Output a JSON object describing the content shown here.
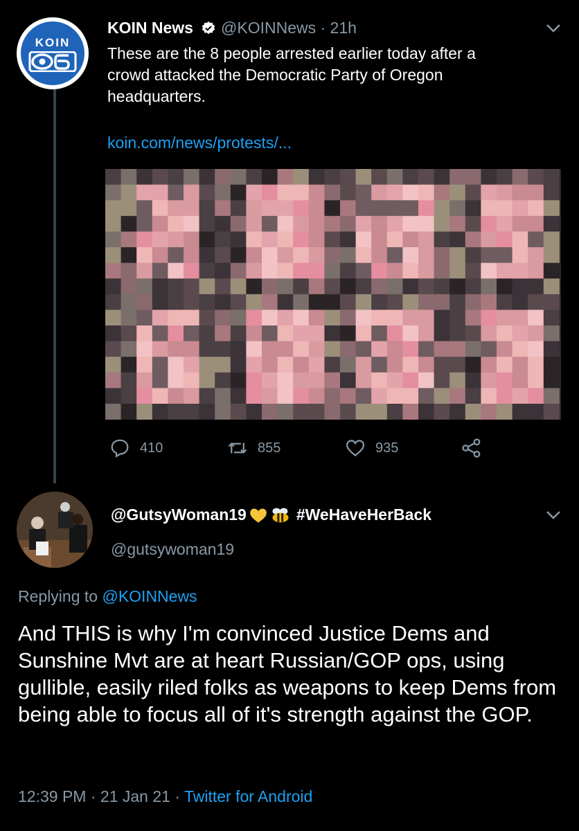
{
  "tweet1": {
    "display_name": "KOIN News",
    "handle": "@KOINNews",
    "separator": " · ",
    "time": "21h",
    "avatar_text_top": "KOIN",
    "avatar_text_bottom": "06",
    "text": "These are the 8 people arrested earlier today after a\ncrowd attacked the Democratic Party of Oregon\nheadquarters.",
    "link": "koin.com/news/protests/...",
    "actions": {
      "replies": "410",
      "retweets": "855",
      "likes": "935"
    }
  },
  "tweet2": {
    "display_name": "@GutsyWoman19",
    "hashtag": "#WeHaveHerBack",
    "handle": "@gutsywoman19",
    "replying_prefix": "Replying to ",
    "replying_to": "@KOINNews",
    "text": "And THIS is why I'm convinced Justice Dems and Sunshine Mvt are at heart Russian/GOP ops, using gullible, easily riled folks as weapons to keep Dems from being able to focus all of it's strength against the GOP.",
    "time": "12:39 PM",
    "date": "21 Jan 21",
    "dot": " · ",
    "source": "Twitter for Android"
  },
  "colors": {
    "background": "#000000",
    "secondary_text": "#8899a6",
    "link": "#1da1f2",
    "thread_line": "#38444d"
  }
}
